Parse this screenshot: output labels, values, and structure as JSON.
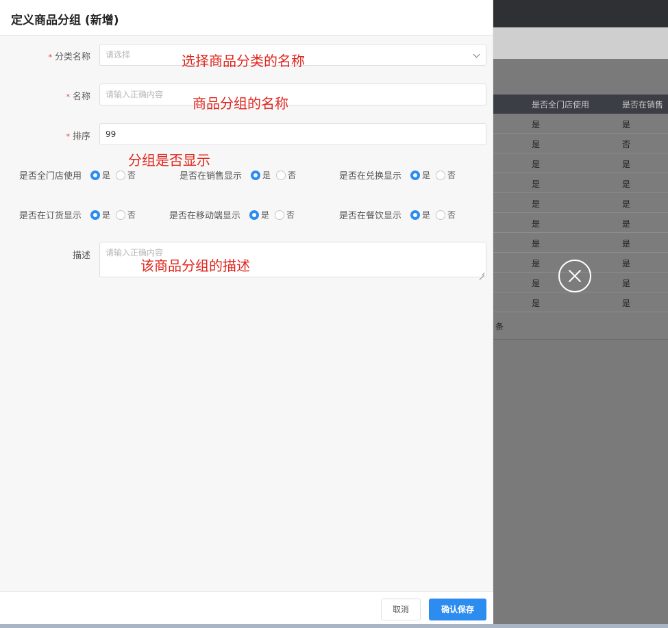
{
  "background": {
    "table": {
      "headers": [
        "是否全门店使用",
        "是否在销售"
      ],
      "rows": [
        [
          "是",
          "是"
        ],
        [
          "是",
          "否"
        ],
        [
          "是",
          "是"
        ],
        [
          "是",
          "是"
        ],
        [
          "是",
          "是"
        ],
        [
          "是",
          "是"
        ],
        [
          "是",
          "是"
        ],
        [
          "是",
          "是"
        ],
        [
          "是",
          "是"
        ],
        [
          "是",
          "是"
        ]
      ],
      "footer_text": "条"
    }
  },
  "drawer": {
    "title": "定义商品分组 (新增)",
    "fields": {
      "category": {
        "label": "分类名称",
        "required_mark": "*",
        "placeholder": "请选择"
      },
      "name": {
        "label": "名称",
        "required_mark": "*",
        "placeholder": "请输入正确内容"
      },
      "sort": {
        "label": "排序",
        "required_mark": "*",
        "value": "99"
      },
      "description": {
        "label": "描述",
        "placeholder": "请输入正确内容"
      }
    },
    "radios": [
      {
        "label": "是否全门店使用",
        "yes": "是",
        "no": "否",
        "selected": "是"
      },
      {
        "label": "是否在销售显示",
        "yes": "是",
        "no": "否",
        "selected": "是"
      },
      {
        "label": "是否在兑换显示",
        "yes": "是",
        "no": "否",
        "selected": "是"
      },
      {
        "label": "是否在订货显示",
        "yes": "是",
        "no": "否",
        "selected": "是"
      },
      {
        "label": "是否在移动端显示",
        "yes": "是",
        "no": "否",
        "selected": "是"
      },
      {
        "label": "是否在餐饮显示",
        "yes": "是",
        "no": "否",
        "selected": "是"
      }
    ],
    "annotations": {
      "category": "选择商品分类的名称",
      "name": "商品分组的名称",
      "display": "分组是否显示",
      "description": "该商品分组的描述"
    },
    "footer": {
      "cancel_label": "取消",
      "save_label": "确认保存"
    }
  },
  "colors": {
    "primary": "#2d8cf0",
    "required": "#e4393c",
    "annotation": "#e0261d"
  }
}
